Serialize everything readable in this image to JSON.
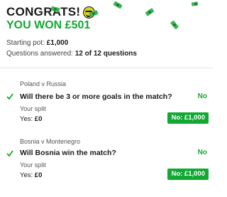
{
  "header": {
    "congrats": "CONGRATS!",
    "won": "YOU WON £501",
    "starting_pot_label": "Starting pot:",
    "starting_pot_value": "£1,000",
    "questions_label": "Questions answered:",
    "questions_value": "12 of 12 questions"
  },
  "questions": [
    {
      "match": "Poland v Russia",
      "question": "Will there be 3 or more goals in the match?",
      "answer": "No",
      "split_label": "Your split",
      "yes_label": "Yes:",
      "yes_value": "£0",
      "no_label": "No: £1,000"
    },
    {
      "match": "Bosnia v Montenegro",
      "question": "Will Bosnia win the match?",
      "answer": "No",
      "split_label": "Your split",
      "yes_label": "Yes:",
      "yes_value": "£0",
      "no_label": "No: £1,000"
    }
  ],
  "colors": {
    "accent": "#12a832",
    "text": "#1a1a1a",
    "muted": "#555555"
  },
  "icons": {
    "emoji": "grinning-face-icon",
    "check": "check-icon",
    "confetti": "money-note-icon"
  }
}
